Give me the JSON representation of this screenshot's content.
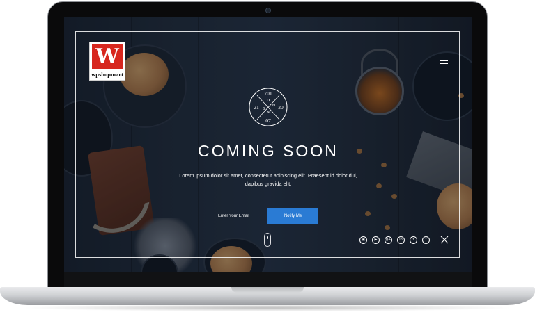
{
  "logo": {
    "letter": "W",
    "name": "wpshopmart"
  },
  "emblem": {
    "top": "701",
    "left": "21",
    "right": "20",
    "bottom": "07",
    "letter_d": "D",
    "letter_h": "H",
    "letter_m": "M",
    "letter_s": "S"
  },
  "hero": {
    "title": "COMING SOON",
    "description": "Lorem ipsum dolor sit amet, consectetur adipiscing elit. Praesent id dolor dui, dapibus gravida elit."
  },
  "form": {
    "email_placeholder": "Enter Your Email",
    "button_label": "Notify Me"
  },
  "social": [
    {
      "icon": "instagram-icon",
      "glyph": "▣"
    },
    {
      "icon": "youtube-icon",
      "glyph": "▶"
    },
    {
      "icon": "google-plus-icon",
      "glyph": "g+"
    },
    {
      "icon": "linkedin-icon",
      "glyph": "in"
    },
    {
      "icon": "twitter-icon",
      "glyph": "t"
    },
    {
      "icon": "facebook-icon",
      "glyph": "f"
    }
  ],
  "colors": {
    "accent": "#2a7bd4",
    "logo_red": "#d7261e"
  }
}
